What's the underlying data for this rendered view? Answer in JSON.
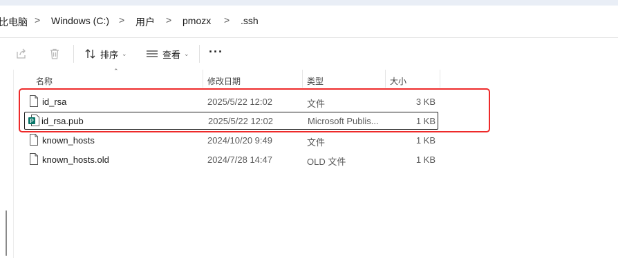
{
  "breadcrumb": {
    "items": [
      "比电脑",
      "Windows (C:)",
      "用户",
      "pmozx",
      ".ssh"
    ],
    "separator": ">"
  },
  "toolbar": {
    "share_icon": "share-icon",
    "delete_icon": "trash-icon",
    "sort_label": "排序",
    "view_label": "查看",
    "more_label": "···"
  },
  "columns": {
    "name": "名称",
    "date": "修改日期",
    "type": "类型",
    "size": "大小"
  },
  "files": [
    {
      "name": "id_rsa",
      "date": "2025/5/22 12:02",
      "type": "文件",
      "size": "3 KB",
      "icon": "blank-file-icon"
    },
    {
      "name": "id_rsa.pub",
      "date": "2025/5/22 12:02",
      "type": "Microsoft Publis...",
      "size": "1 KB",
      "icon": "publisher-file-icon"
    },
    {
      "name": "known_hosts",
      "date": "2024/10/20 9:49",
      "type": "文件",
      "size": "1 KB",
      "icon": "blank-file-icon"
    },
    {
      "name": "known_hosts.old",
      "date": "2024/7/28 14:47",
      "type": "OLD 文件",
      "size": "1 KB",
      "icon": "blank-file-icon"
    }
  ],
  "colors": {
    "highlight": "#ee2a2a",
    "publisher_green": "#077568"
  }
}
